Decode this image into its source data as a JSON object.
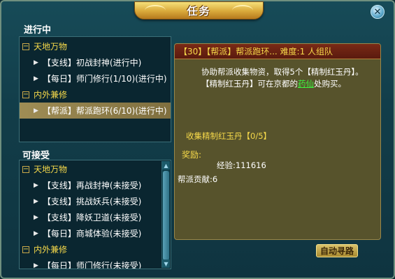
{
  "window": {
    "title": "任务"
  },
  "close_icon": "close-icon",
  "in_progress": {
    "label": "进行中",
    "rows": [
      {
        "type": "category",
        "text": "天地万物"
      },
      {
        "type": "item",
        "text": "【支线】初战封神(进行中)"
      },
      {
        "type": "item",
        "text": "【每日】师门修行(1/10)(进行中)"
      },
      {
        "type": "category",
        "text": "内外兼修"
      },
      {
        "type": "item",
        "text": "【帮派】帮派跑环(6/10)(进行中)",
        "selected": true
      }
    ]
  },
  "available": {
    "label": "可接受",
    "rows": [
      {
        "type": "category",
        "text": "天地万物"
      },
      {
        "type": "item",
        "text": "【支线】再战封神(未接受)"
      },
      {
        "type": "item",
        "text": "【支线】挑战妖兵(未接受)"
      },
      {
        "type": "item",
        "text": "【支线】降妖卫道(未接受)"
      },
      {
        "type": "item",
        "text": "【每日】商城体验(未接受)"
      },
      {
        "type": "category",
        "text": "内外兼修"
      },
      {
        "type": "item",
        "text": "【每日】师门修行(未接受)"
      }
    ]
  },
  "detail": {
    "header": "【30】【帮派】帮派跑环... 难度:1 人组队",
    "desc_line1": "协助帮派收集物资，取得5个【精制红玉丹】。",
    "desc_line2_pre": "【精制红玉丹】可在京都的",
    "desc_npc": "药仙",
    "desc_line2_post": "处购买。",
    "goal": "收集精制红玉丹【0/5】",
    "reward_label": "奖励:",
    "reward_exp": "经验:111616",
    "reward_contrib": "帮派贡献:6"
  },
  "auto_button": "自动寻路",
  "colors": {
    "accent_yellow": "#f6d94a",
    "npc_green": "#3ff33f",
    "selected_row": "#9f8d55"
  }
}
